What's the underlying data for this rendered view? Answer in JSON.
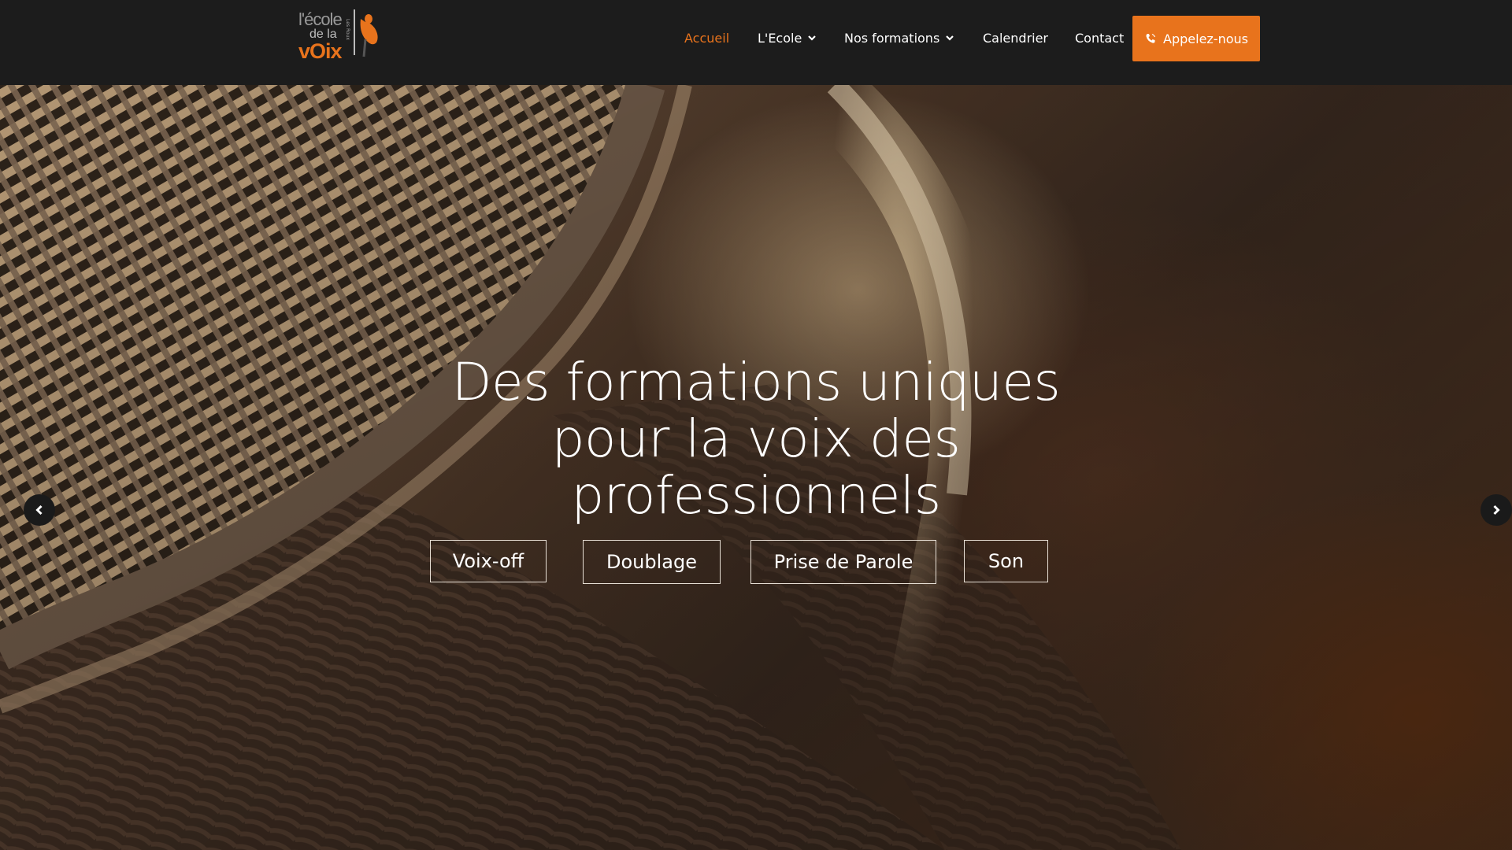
{
  "header": {
    "logo": {
      "line1": "l'école",
      "line2": "de la",
      "line3": "vOix",
      "side": "Les Roux"
    },
    "nav": [
      {
        "label": "Accueil",
        "active": true,
        "dropdown": false
      },
      {
        "label": "L'Ecole",
        "active": false,
        "dropdown": true
      },
      {
        "label": "Nos formations",
        "active": false,
        "dropdown": true
      },
      {
        "label": "Calendrier",
        "active": false,
        "dropdown": false
      },
      {
        "label": "Contact",
        "active": false,
        "dropdown": false
      }
    ],
    "cta": {
      "label": "Appelez-nous",
      "icon": "phone-icon"
    }
  },
  "hero": {
    "title_lines": [
      "Des formations uniques",
      "pour la voix des",
      "professionnels"
    ],
    "tags": [
      "Voix-off",
      "Doublage",
      "Prise de Parole",
      "Son"
    ],
    "prev_icon": "chevron-left-icon",
    "next_icon": "chevron-right-icon"
  },
  "colors": {
    "accent": "#e8731c",
    "header_bg": "#1c1c1c",
    "text": "#ffffff"
  }
}
